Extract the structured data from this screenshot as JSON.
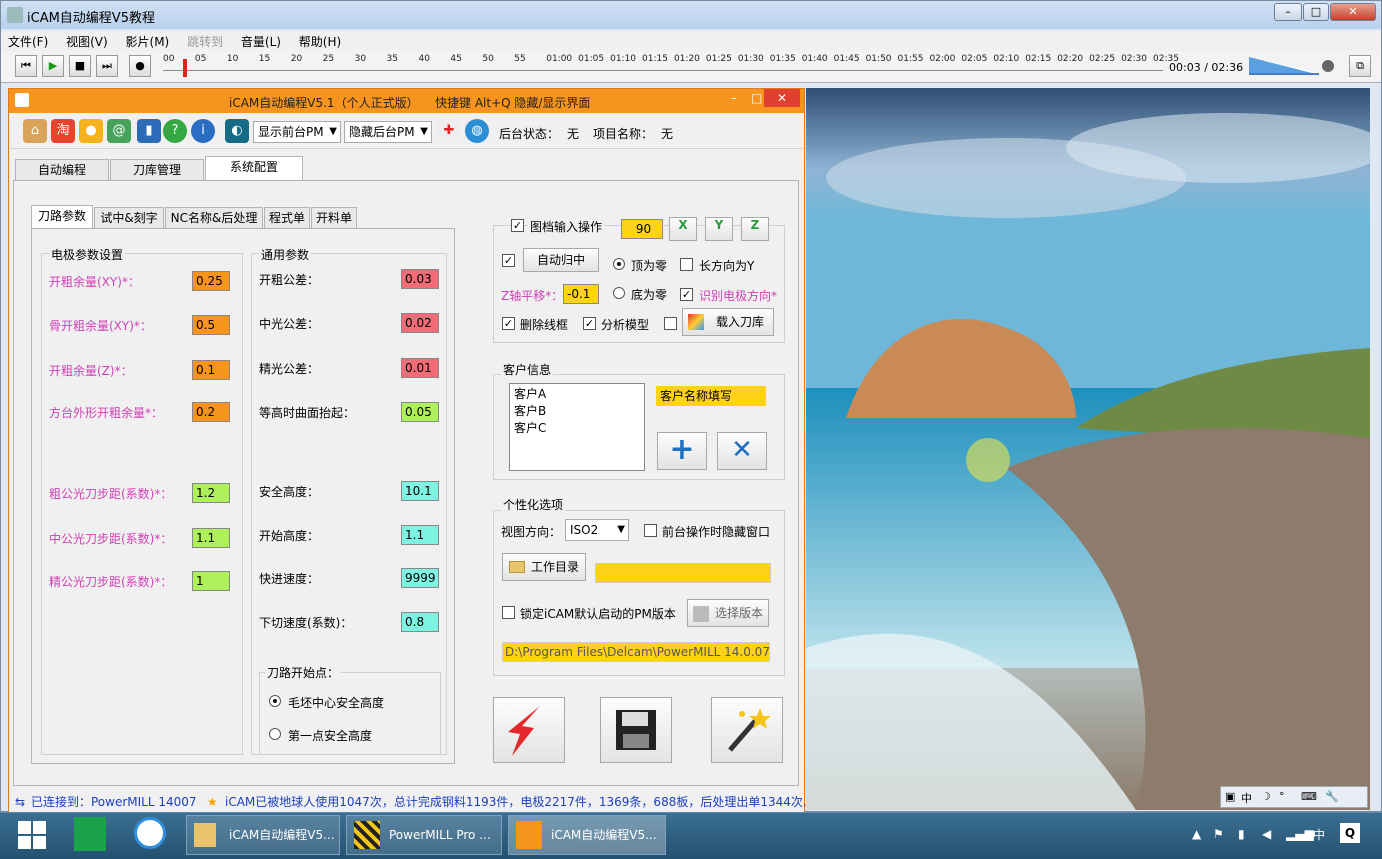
{
  "player": {
    "title": "iCAM自动编程V5教程",
    "menu": [
      "文件(F)",
      "视图(V)",
      "影片(M)",
      "跳转到",
      "音量(L)",
      "帮助(H)"
    ],
    "ticks": [
      "00",
      "05",
      "10",
      "15",
      "20",
      "25",
      "30",
      "35",
      "40",
      "45",
      "50",
      "55",
      "01:00",
      "01:05",
      "01:10",
      "01:15",
      "01:20",
      "01:25",
      "01:30",
      "01:35",
      "01:40",
      "01:45",
      "01:50",
      "01:55",
      "02:00",
      "02:05",
      "02:10",
      "02:15",
      "02:20",
      "02:25",
      "02:30",
      "02:35"
    ],
    "time": "00:03 / 02:36",
    "progress": 0.02,
    "volume": 0.9,
    "min": "–",
    "max": "□",
    "close": "✕"
  },
  "icam": {
    "title": "iCAM自动编程V5.1（个人正式版）",
    "hotkey": "快捷键 Alt+Q 隐藏/显示界面",
    "toolbar": {
      "show_pm": "显示前台PM",
      "hide_pm": "隐藏后台PM",
      "bg_status_label": "后台状态：",
      "bg_status_value": "无",
      "project_label": "项目名称：",
      "project_value": "无"
    },
    "main_tabs": [
      "自动编程",
      "刀库管理",
      "系统配置"
    ],
    "sub_tabs": [
      "刀路参数",
      "试中&刻字",
      "NC名称&后处理",
      "程式单",
      "开料单"
    ],
    "electrode": {
      "title": "电极参数设置",
      "rows": [
        {
          "label": "开粗余量(XY)*：",
          "value": "0.25",
          "color": "or"
        },
        {
          "label": "骨开粗余量(XY)*：",
          "value": "0.5",
          "color": "or"
        },
        {
          "label": "开粗余量(Z)*：",
          "value": "0.1",
          "color": "or"
        },
        {
          "label": "方台外形开粗余量*：",
          "value": "0.2",
          "color": "or"
        },
        {
          "label": "粗公光刀步距(系数)*：",
          "value": "1.2",
          "color": "gr"
        },
        {
          "label": "中公光刀步距(系数)*：",
          "value": "1.1",
          "color": "gr"
        },
        {
          "label": "精公光刀步距(系数)*：",
          "value": "1",
          "color": "gr"
        }
      ]
    },
    "general": {
      "title": "通用参数",
      "rows": [
        {
          "label": "开粗公差：",
          "value": "0.03",
          "color": "rd"
        },
        {
          "label": "中光公差：",
          "value": "0.02",
          "color": "rd"
        },
        {
          "label": "精光公差：",
          "value": "0.01",
          "color": "rd"
        },
        {
          "label": "等高时曲面抬起：",
          "value": "0.05",
          "color": "gr"
        },
        {
          "label": "安全高度：",
          "value": "10.1",
          "color": "cy"
        },
        {
          "label": "开始高度：",
          "value": "1.1",
          "color": "cy"
        },
        {
          "label": "快进速度：",
          "value": "9999",
          "color": "cy"
        },
        {
          "label": "下切速度(系数)：",
          "value": "0.8",
          "color": "cy"
        }
      ],
      "start_title": "刀路开始点：",
      "start_opts": [
        "毛坯中心安全高度",
        "第一点安全高度"
      ]
    },
    "drawing": {
      "label": "图档输入操作",
      "angle": "90",
      "auto_center": "自动归中",
      "top_zero": "顶为零",
      "long_y": "长方向为Y",
      "z_label": "Z轴平移*：",
      "z_value": "-0.1",
      "bottom_zero": "底为零",
      "detect": "识别电极方向*",
      "del_frame": "删除线框",
      "analyze": "分析模型",
      "load_lib": "载入刀库"
    },
    "client": {
      "title": "客户信息",
      "items": [
        "客户A",
        "客户B",
        "客户C"
      ],
      "placeholder": "客户名称填写"
    },
    "personal": {
      "title": "个性化选项",
      "view_label": "视图方向：",
      "view_value": "ISO2",
      "hide_win": "前台操作时隐藏窗口",
      "workdir": "工作目录",
      "lock": "锁定iCAM默认启动的PM版本",
      "select_ver": "选择版本",
      "path": "D:\\Program Files\\Delcam\\PowerMILL 14.0.07\\"
    },
    "status": {
      "connected": "已连接到：PowerMILL 14007",
      "stats": "iCAM已被地球人使用1047次，总计完成钢料1193件，电极2217件，1369条，688板，后处理出单1344次."
    }
  },
  "tray": {
    "items": [
      "中",
      "☽",
      "°",
      "⌨",
      "🔧"
    ],
    "lang": "中",
    "letter": "Q"
  },
  "taskbar": {
    "items": [
      "iCAM自动编程V5...",
      "PowerMILL Pro ...",
      "iCAM自动编程V5..."
    ]
  }
}
